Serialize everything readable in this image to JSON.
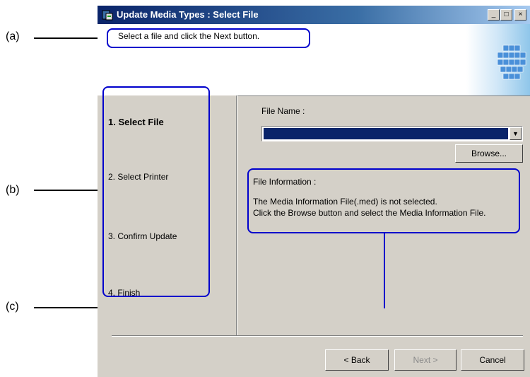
{
  "window": {
    "title": "Update Media Types : Select File",
    "minimize_glyph": "_",
    "maximize_glyph": "□",
    "close_glyph": "×",
    "instruction": "Select a file and click the Next button."
  },
  "steps": [
    {
      "label": "1.  Select File",
      "active": true
    },
    {
      "label": "2.  Select Printer",
      "active": false
    },
    {
      "label": "3.  Confirm Update",
      "active": false
    },
    {
      "label": "4.  Finish",
      "active": false
    }
  ],
  "file": {
    "label": "File Name :",
    "value": "",
    "browse_label": "Browse..."
  },
  "info": {
    "title": "File Information :",
    "line1": "The Media Information File(.med) is not selected.",
    "line2": "Click the Browse button and select the Media Information File."
  },
  "buttons": {
    "back": "< Back",
    "next": "Next >",
    "cancel": "Cancel"
  },
  "callouts": {
    "a": "(a)",
    "b": "(b)",
    "c": "(c)"
  },
  "colors": {
    "title_active": "#0a246a",
    "face": "#d4d0c8",
    "callout": "#0000cc",
    "selection": "#0a246a"
  }
}
